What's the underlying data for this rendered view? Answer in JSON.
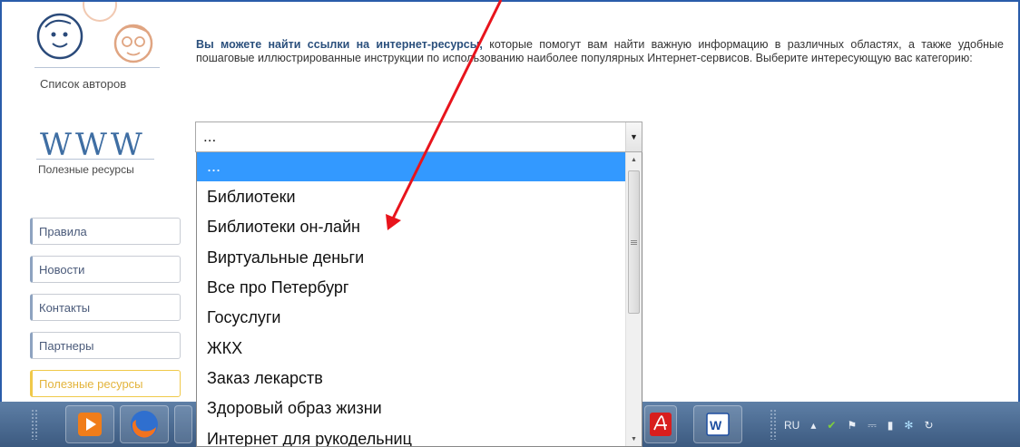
{
  "sidebar": {
    "authors_label": "Список авторов",
    "www_logo": "WWW",
    "www_label": "Полезные ресурсы",
    "nav": [
      {
        "label": "Правила",
        "active": false
      },
      {
        "label": "Новости",
        "active": false
      },
      {
        "label": "Контакты",
        "active": false
      },
      {
        "label": "Партнеры",
        "active": false
      },
      {
        "label": "Полезные ресурсы",
        "active": true
      }
    ]
  },
  "main": {
    "intro_bold": "Вы можете найти ссылки на интернет-ресурсы,",
    "intro_rest": " которые помогут вам найти важную информацию в различных областях, а также удобные пошаговые иллюстрированные инструкции  по использованию наиболее популярных Интернет-сервисов. Выберите интересующую вас категорию:",
    "select_value": "...",
    "options": [
      "...",
      "Библиотеки",
      "Библиотеки он-лайн",
      "Виртуальные деньги",
      "Все про Петербург",
      "Госуслуги",
      "ЖКХ",
      "Заказ лекарств",
      "Здоровый образ жизни",
      "Интернет для рукодельниц"
    ],
    "selected_index": 0
  },
  "taskbar": {
    "apps": [
      "media-player-icon",
      "firefox-icon",
      "acrobat-icon",
      "word-icon"
    ],
    "language": "RU"
  },
  "colors": {
    "frame": "#2a5caa",
    "highlight": "#3399ff",
    "active_nav": "#f0c94a",
    "arrow": "#e8141c",
    "taskbar": "#4a6a92"
  }
}
